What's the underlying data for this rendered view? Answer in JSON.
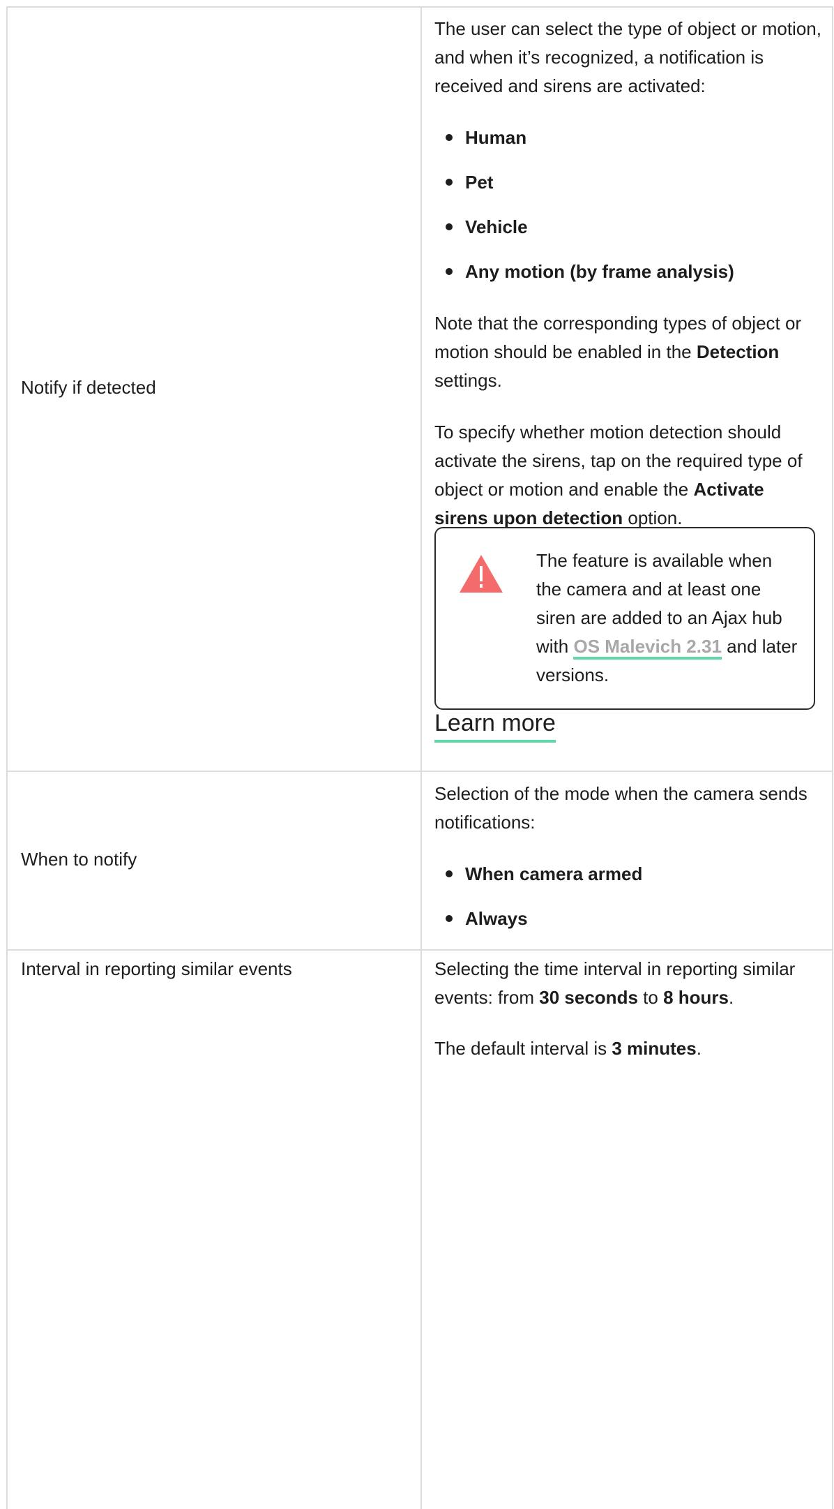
{
  "rows": [
    {
      "label": "Notify if detected",
      "intro": "The user can select the type of object or motion, and when it’s recognized, a notification is received and sirens are activated:",
      "items": [
        "Human",
        "Pet",
        "Vehicle",
        "Any motion (by frame analysis)"
      ],
      "note": {
        "before": "Note that the corresponding types of object or motion should be enabled in the ",
        "bold": "Detection",
        "after": " settings."
      },
      "sirens": {
        "before": "To specify whether motion detection should activate the sirens, tap on the required type of object or motion and enable the ",
        "bold": "Activate sirens upon detection",
        "after": " option."
      },
      "warning": {
        "icon": "warning-triangle-icon",
        "icon_color": "#f46b6b",
        "text_before": "The feature is available when the camera and at least one siren are added to an Ajax hub with ",
        "link": "OS Malevich 2.31",
        "text_after": " and later versions."
      },
      "learn_more": "Learn more"
    },
    {
      "label": "When to notify",
      "intro": "Selection of the mode when the camera sends notifications:",
      "items": [
        "When camera armed",
        "Always"
      ]
    },
    {
      "label": "Interval in reporting similar events",
      "interval": {
        "before": "Selecting the time interval in reporting similar events: from ",
        "min": "30 seconds",
        "mid": " to ",
        "max": "8 hours",
        "end": "."
      },
      "default": {
        "before": "The default interval is ",
        "value": "3 minutes",
        "end": "."
      }
    }
  ],
  "colors": {
    "border": "#dcdcdc",
    "accent_underline": "#63d6a8",
    "link_text": "#a8a8a8",
    "warning_icon": "#f46b6b"
  }
}
